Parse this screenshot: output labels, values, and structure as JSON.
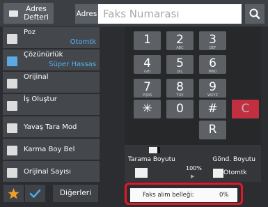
{
  "header": {
    "address_book_label": "Adres Defteri",
    "address_label": "Adres",
    "fax_number_placeholder": "Faks Numarası"
  },
  "left_panel": {
    "items": [
      {
        "label": "Poz",
        "value": "Otomtk"
      },
      {
        "label": "Çözünürlük",
        "value": "Süper Hassas"
      },
      {
        "label": "Orijinal",
        "value": ""
      },
      {
        "label": "İş Oluştur",
        "value": ""
      },
      {
        "label": "Yavaş Tara Mod",
        "value": ""
      },
      {
        "label": "Karma Boy Bel",
        "value": ""
      },
      {
        "label": "Orijinal Sayısı",
        "value": ""
      }
    ],
    "others_label": "Diğerleri"
  },
  "keypad": {
    "keys": [
      {
        "main": "1",
        "sub": ""
      },
      {
        "main": "2",
        "sub": "ABC"
      },
      {
        "main": "3",
        "sub": "DEF"
      },
      {
        "main": "4",
        "sub": "GHI"
      },
      {
        "main": "5",
        "sub": "JKL"
      },
      {
        "main": "6",
        "sub": "MNO"
      },
      {
        "main": "7",
        "sub": "PQRS"
      },
      {
        "main": "8",
        "sub": "TUV"
      },
      {
        "main": "9",
        "sub": "WXYZ"
      },
      {
        "main": "✳",
        "sub": ""
      },
      {
        "main": "0",
        "sub": ""
      },
      {
        "main": "#",
        "sub": ""
      },
      {
        "main": "C",
        "sub": ""
      },
      {
        "main": "R",
        "sub": ""
      }
    ]
  },
  "status": {
    "scan_size_label": "Tarama Boyutu",
    "send_size_label": "Gönd. Boyutu",
    "ratio": "100%",
    "send_size_value": "Otomtk"
  },
  "receipt": {
    "label": "Faks alım belleği:",
    "value": "0%"
  },
  "colors": {
    "accent_blue": "#55b4f2",
    "highlight_red": "#e2182a",
    "star_orange": "#f0a028",
    "check_blue": "#4aa9e8"
  }
}
